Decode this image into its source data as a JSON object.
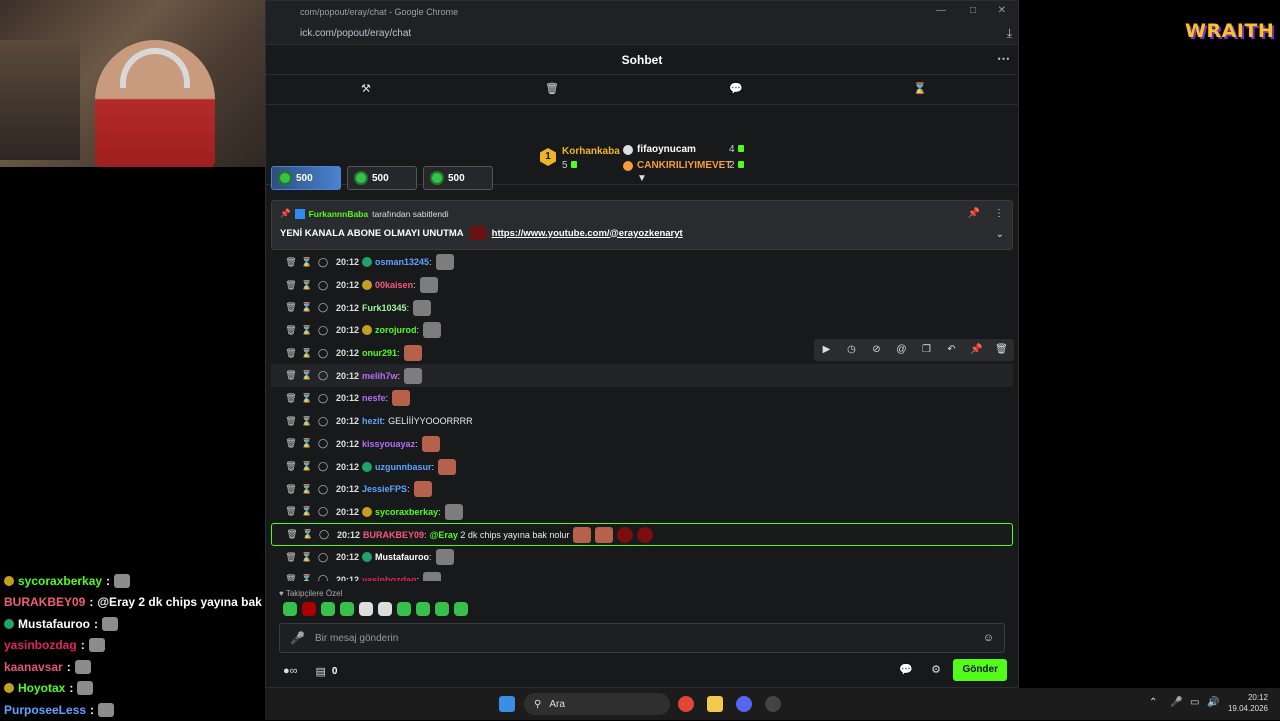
{
  "overlay": {
    "brand": "WRAITH",
    "feed": [
      {
        "user": "sycoraxberkay",
        "text": "",
        "color": "#53fc18",
        "badge": "#c4a020"
      },
      {
        "user": "BURAKBEY09",
        "text": "@Eray 2 dk chips yayına bak nolur",
        "color": "#f25c7c",
        "badge": ""
      },
      {
        "user": "Mustafauroo",
        "text": "",
        "color": "#ffffff",
        "badge": "#1fa36a"
      },
      {
        "user": "yasinbozdag",
        "text": "",
        "color": "#e0245e",
        "badge": ""
      },
      {
        "user": "kaanavsar",
        "text": "",
        "color": "#e05a6e",
        "badge": ""
      },
      {
        "user": "Hoyotax",
        "text": "",
        "color": "#53fc18",
        "badge": "#c4a020"
      },
      {
        "user": "PurposeeLess",
        "text": "",
        "color": "#5fa3ff",
        "badge": ""
      }
    ]
  },
  "window": {
    "title": "com/popout/eray/chat - Google Chrome",
    "url": "ick.com/popout/eray/chat"
  },
  "chat": {
    "title": "Sohbet",
    "leaderboard": {
      "first": {
        "name": "Korhankaba",
        "rank": "1",
        "count": "5"
      },
      "others": [
        {
          "name": "fifaoynucam",
          "count": "4",
          "color": "#ffffff"
        },
        {
          "name": "CANKIRILIYIMEVET",
          "count": "2",
          "color": "#f59e3b"
        }
      ]
    },
    "gifts": [
      "500",
      "500",
      "500"
    ],
    "pinned": {
      "by_user": "FurkannnBaba",
      "by_suffix": "tarafından sabitlendi",
      "text": "YENİ KANALA ABONE OLMAYI UNUTMA",
      "link": "https://www.youtube.com/@erayozkenaryt"
    },
    "messages": [
      {
        "time": "20:12",
        "user": "osman13245",
        "color": "#5fa3ff",
        "text": "",
        "emotes": [
          "grey"
        ],
        "badge": "#1fa36a"
      },
      {
        "time": "20:12",
        "user": "00kaisen",
        "color": "#f25c7c",
        "text": "",
        "emotes": [
          "grey"
        ],
        "badge": "#c4a020"
      },
      {
        "time": "20:12",
        "user": "Furk10345",
        "color": "#9cf5a0",
        "text": "",
        "emotes": [
          "grey"
        ],
        "badge": ""
      },
      {
        "time": "20:12",
        "user": "zorojurod",
        "color": "#53fc18",
        "text": "",
        "emotes": [
          "grey"
        ],
        "badge": "#c4a020"
      },
      {
        "time": "20:12",
        "user": "onur291",
        "color": "#53fc18",
        "text": "",
        "emotes": [
          "face"
        ],
        "badge": ""
      },
      {
        "time": "20:12",
        "user": "melih7w",
        "color": "#b86cf5",
        "text": "",
        "emotes": [
          "grey"
        ],
        "badge": ""
      },
      {
        "time": "20:12",
        "user": "nesfe",
        "color": "#b86cf5",
        "text": "",
        "emotes": [
          "face"
        ],
        "badge": ""
      },
      {
        "time": "20:12",
        "user": "hezit",
        "color": "#5fa3ff",
        "text": "GELİİİYYOOORRRR",
        "emotes": [],
        "badge": ""
      },
      {
        "time": "20:12",
        "user": "kissyouayaz",
        "color": "#b86cf5",
        "text": "",
        "emotes": [
          "face"
        ],
        "badge": ""
      },
      {
        "time": "20:12",
        "user": "uzgunnbasur",
        "color": "#5fa3ff",
        "text": "",
        "emotes": [
          "face"
        ],
        "badge": "#1fa36a"
      },
      {
        "time": "20:12",
        "user": "JessieFPS",
        "color": "#5fa3ff",
        "text": "",
        "emotes": [
          "face"
        ],
        "badge": ""
      },
      {
        "time": "20:12",
        "user": "sycoraxberkay",
        "color": "#53fc18",
        "text": "",
        "emotes": [
          "grey"
        ],
        "badge": "#c4a020"
      },
      {
        "time": "20:12",
        "user": "BURAKBEY09",
        "color": "#f25c7c",
        "text": "@Eray 2 dk chips yayına bak nolur",
        "emotes": [
          "face",
          "face",
          "red",
          "red"
        ],
        "badge": ""
      },
      {
        "time": "20:12",
        "user": "Mustafauroo",
        "color": "#ffffff",
        "text": "",
        "emotes": [
          "grey"
        ],
        "badge": "#1fa36a"
      },
      {
        "time": "20:12",
        "user": "yasinbozdag",
        "color": "#e0245e",
        "text": "",
        "emotes": [
          "grey"
        ],
        "badge": ""
      }
    ],
    "follower_only": "Takipçilere Özel",
    "input_placeholder": "Bir mesaj gönderin",
    "viewer_count": "0",
    "send_label": "Gönder"
  },
  "taskbar": {
    "search_label": "Ara",
    "time": "20:12",
    "date": "19.04.2026"
  }
}
